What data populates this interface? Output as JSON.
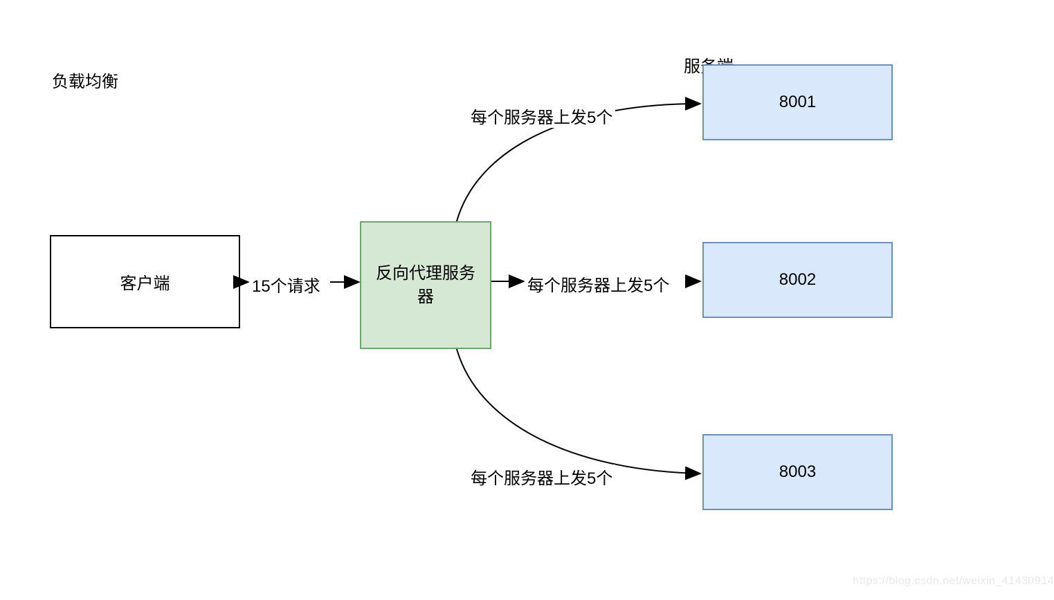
{
  "title": "负载均衡",
  "server_header": "服务端",
  "nodes": {
    "client": "客户端",
    "proxy": "反向代理服务\n器",
    "server1": "8001",
    "server2": "8002",
    "server3": "8003"
  },
  "edges": {
    "requests": "15个请求",
    "to_server1": "每个服务器上发5个",
    "to_server2": "每个服务器上发5个",
    "to_server3": "每个服务器上发5个"
  },
  "watermark": "https://blog.csdn.net/weixin_41430914",
  "chart_data": {
    "type": "diagram",
    "title": "负载均衡",
    "nodes": [
      {
        "id": "client",
        "label": "客户端",
        "type": "plain"
      },
      {
        "id": "proxy",
        "label": "反向代理服务器",
        "type": "proxy"
      },
      {
        "id": "s1",
        "label": "8001",
        "type": "server"
      },
      {
        "id": "s2",
        "label": "8002",
        "type": "server"
      },
      {
        "id": "s3",
        "label": "8003",
        "type": "server"
      }
    ],
    "edges": [
      {
        "from": "client",
        "to": "proxy",
        "label": "15个请求"
      },
      {
        "from": "proxy",
        "to": "s1",
        "label": "每个服务器上发5个"
      },
      {
        "from": "proxy",
        "to": "s2",
        "label": "每个服务器上发5个"
      },
      {
        "from": "proxy",
        "to": "s3",
        "label": "每个服务器上发5个"
      }
    ],
    "annotations": [
      "服务端"
    ]
  }
}
